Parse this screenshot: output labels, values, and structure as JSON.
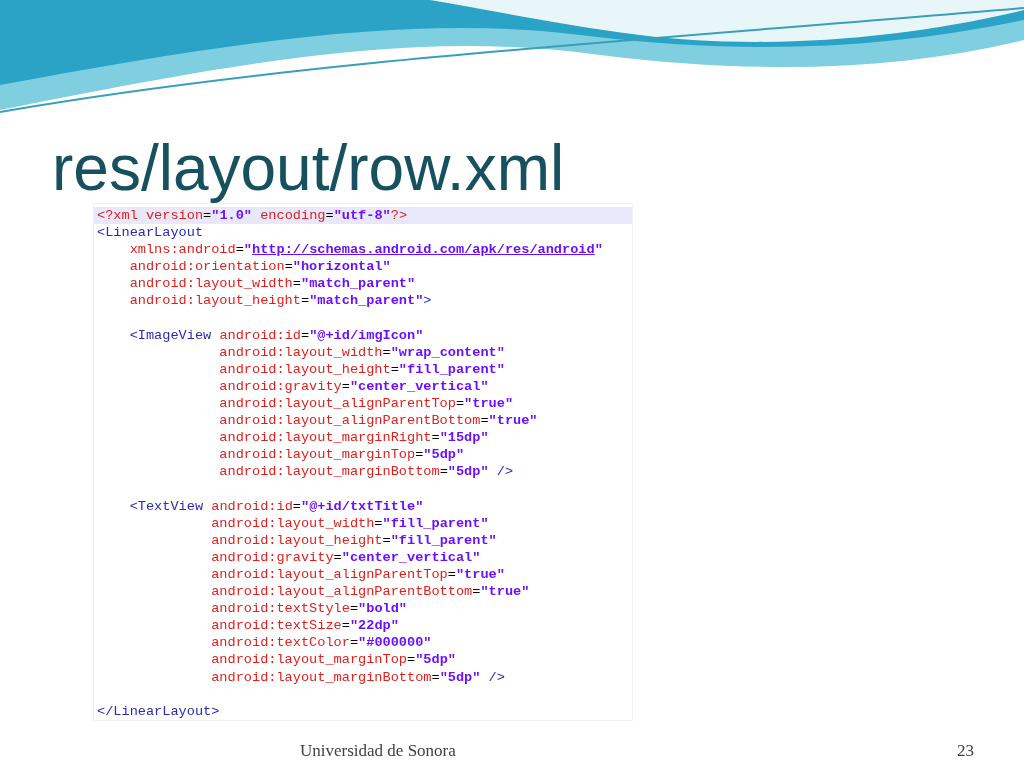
{
  "slide": {
    "title": "res/layout/row.xml",
    "code_lines": [
      {
        "kind": "code",
        "highlighted": true,
        "tokens": [
          {
            "kind": "attr",
            "text": "<?xml version"
          },
          {
            "kind": "plain",
            "text": "="
          },
          {
            "kind": "value",
            "text": "\"1.0\""
          },
          {
            "kind": "attr",
            "text": " encoding"
          },
          {
            "kind": "plain",
            "text": "="
          },
          {
            "kind": "value",
            "text": "\"utf-8\""
          },
          {
            "kind": "attr",
            "text": "?>"
          }
        ]
      },
      {
        "kind": "code",
        "highlighted": false,
        "tokens": [
          {
            "kind": "tag",
            "text": "<LinearLayout"
          }
        ]
      },
      {
        "kind": "code",
        "highlighted": false,
        "tokens": [
          {
            "kind": "attr",
            "text": "    xmlns:android"
          },
          {
            "kind": "plain",
            "text": "="
          },
          {
            "kind": "value",
            "text": "\""
          },
          {
            "kind": "link",
            "text": "http://schemas.android.com/apk/res/android"
          },
          {
            "kind": "value",
            "text": "\""
          }
        ]
      },
      {
        "kind": "code",
        "highlighted": false,
        "tokens": [
          {
            "kind": "attr",
            "text": "    android:orientation"
          },
          {
            "kind": "plain",
            "text": "="
          },
          {
            "kind": "value",
            "text": "\"horizontal\""
          }
        ]
      },
      {
        "kind": "code",
        "highlighted": false,
        "tokens": [
          {
            "kind": "attr",
            "text": "    android:layout_width"
          },
          {
            "kind": "plain",
            "text": "="
          },
          {
            "kind": "value",
            "text": "\"match_parent\""
          }
        ]
      },
      {
        "kind": "code",
        "highlighted": false,
        "tokens": [
          {
            "kind": "attr",
            "text": "    android:layout_height"
          },
          {
            "kind": "plain",
            "text": "="
          },
          {
            "kind": "value",
            "text": "\"match_parent\""
          },
          {
            "kind": "tag",
            "text": ">"
          }
        ]
      },
      {
        "kind": "blank"
      },
      {
        "kind": "code",
        "highlighted": false,
        "tokens": [
          {
            "kind": "tag",
            "text": "    <ImageView"
          },
          {
            "kind": "attr",
            "text": " android:id"
          },
          {
            "kind": "plain",
            "text": "="
          },
          {
            "kind": "value",
            "text": "\"@+id/imgIcon\""
          }
        ]
      },
      {
        "kind": "code",
        "highlighted": false,
        "tokens": [
          {
            "kind": "attr",
            "text": "               android:layout_width"
          },
          {
            "kind": "plain",
            "text": "="
          },
          {
            "kind": "value",
            "text": "\"wrap_content\""
          }
        ]
      },
      {
        "kind": "code",
        "highlighted": false,
        "tokens": [
          {
            "kind": "attr",
            "text": "               android:layout_height"
          },
          {
            "kind": "plain",
            "text": "="
          },
          {
            "kind": "value",
            "text": "\"fill_parent\""
          }
        ]
      },
      {
        "kind": "code",
        "highlighted": false,
        "tokens": [
          {
            "kind": "attr",
            "text": "               android:gravity"
          },
          {
            "kind": "plain",
            "text": "="
          },
          {
            "kind": "value",
            "text": "\"center_vertical\""
          }
        ]
      },
      {
        "kind": "code",
        "highlighted": false,
        "tokens": [
          {
            "kind": "attr",
            "text": "               android:layout_alignParentTop"
          },
          {
            "kind": "plain",
            "text": "="
          },
          {
            "kind": "value",
            "text": "\"true\""
          }
        ]
      },
      {
        "kind": "code",
        "highlighted": false,
        "tokens": [
          {
            "kind": "attr",
            "text": "               android:layout_alignParentBottom"
          },
          {
            "kind": "plain",
            "text": "="
          },
          {
            "kind": "value",
            "text": "\"true\""
          }
        ]
      },
      {
        "kind": "code",
        "highlighted": false,
        "tokens": [
          {
            "kind": "attr",
            "text": "               android:layout_marginRight"
          },
          {
            "kind": "plain",
            "text": "="
          },
          {
            "kind": "value",
            "text": "\"15dp\""
          }
        ]
      },
      {
        "kind": "code",
        "highlighted": false,
        "tokens": [
          {
            "kind": "attr",
            "text": "               android:layout_marginTop"
          },
          {
            "kind": "plain",
            "text": "="
          },
          {
            "kind": "value",
            "text": "\"5dp\""
          }
        ]
      },
      {
        "kind": "code",
        "highlighted": false,
        "tokens": [
          {
            "kind": "attr",
            "text": "               android:layout_marginBottom"
          },
          {
            "kind": "plain",
            "text": "="
          },
          {
            "kind": "value",
            "text": "\"5dp\""
          },
          {
            "kind": "tag",
            "text": " />"
          }
        ]
      },
      {
        "kind": "blank"
      },
      {
        "kind": "code",
        "highlighted": false,
        "tokens": [
          {
            "kind": "tag",
            "text": "    <TextView"
          },
          {
            "kind": "attr",
            "text": " android:id"
          },
          {
            "kind": "plain",
            "text": "="
          },
          {
            "kind": "value",
            "text": "\"@+id/txtTitle\""
          }
        ]
      },
      {
        "kind": "code",
        "highlighted": false,
        "tokens": [
          {
            "kind": "attr",
            "text": "              android:layout_width"
          },
          {
            "kind": "plain",
            "text": "="
          },
          {
            "kind": "value",
            "text": "\"fill_parent\""
          }
        ]
      },
      {
        "kind": "code",
        "highlighted": false,
        "tokens": [
          {
            "kind": "attr",
            "text": "              android:layout_height"
          },
          {
            "kind": "plain",
            "text": "="
          },
          {
            "kind": "value",
            "text": "\"fill_parent\""
          }
        ]
      },
      {
        "kind": "code",
        "highlighted": false,
        "tokens": [
          {
            "kind": "attr",
            "text": "              android:gravity"
          },
          {
            "kind": "plain",
            "text": "="
          },
          {
            "kind": "value",
            "text": "\"center_vertical\""
          }
        ]
      },
      {
        "kind": "code",
        "highlighted": false,
        "tokens": [
          {
            "kind": "attr",
            "text": "              android:layout_alignParentTop"
          },
          {
            "kind": "plain",
            "text": "="
          },
          {
            "kind": "value",
            "text": "\"true\""
          }
        ]
      },
      {
        "kind": "code",
        "highlighted": false,
        "tokens": [
          {
            "kind": "attr",
            "text": "              android:layout_alignParentBottom"
          },
          {
            "kind": "plain",
            "text": "="
          },
          {
            "kind": "value",
            "text": "\"true\""
          }
        ]
      },
      {
        "kind": "code",
        "highlighted": false,
        "tokens": [
          {
            "kind": "attr",
            "text": "              android:textStyle"
          },
          {
            "kind": "plain",
            "text": "="
          },
          {
            "kind": "value",
            "text": "\"bold\""
          }
        ]
      },
      {
        "kind": "code",
        "highlighted": false,
        "tokens": [
          {
            "kind": "attr",
            "text": "              android:textSize"
          },
          {
            "kind": "plain",
            "text": "="
          },
          {
            "kind": "value",
            "text": "\"22dp\""
          }
        ]
      },
      {
        "kind": "code",
        "highlighted": false,
        "tokens": [
          {
            "kind": "attr",
            "text": "              android:textColor"
          },
          {
            "kind": "plain",
            "text": "="
          },
          {
            "kind": "value",
            "text": "\"#000000\""
          }
        ]
      },
      {
        "kind": "code",
        "highlighted": false,
        "tokens": [
          {
            "kind": "attr",
            "text": "              android:layout_marginTop"
          },
          {
            "kind": "plain",
            "text": "="
          },
          {
            "kind": "value",
            "text": "\"5dp\""
          }
        ]
      },
      {
        "kind": "code",
        "highlighted": false,
        "tokens": [
          {
            "kind": "attr",
            "text": "              android:layout_marginBottom"
          },
          {
            "kind": "plain",
            "text": "="
          },
          {
            "kind": "value",
            "text": "\"5dp\""
          },
          {
            "kind": "tag",
            "text": " />"
          }
        ]
      },
      {
        "kind": "blank"
      },
      {
        "kind": "code",
        "highlighted": false,
        "tokens": [
          {
            "kind": "tag",
            "text": "</LinearLayout>"
          }
        ]
      }
    ],
    "footer": {
      "text": "Universidad de Sonora",
      "page_number": "23"
    }
  }
}
